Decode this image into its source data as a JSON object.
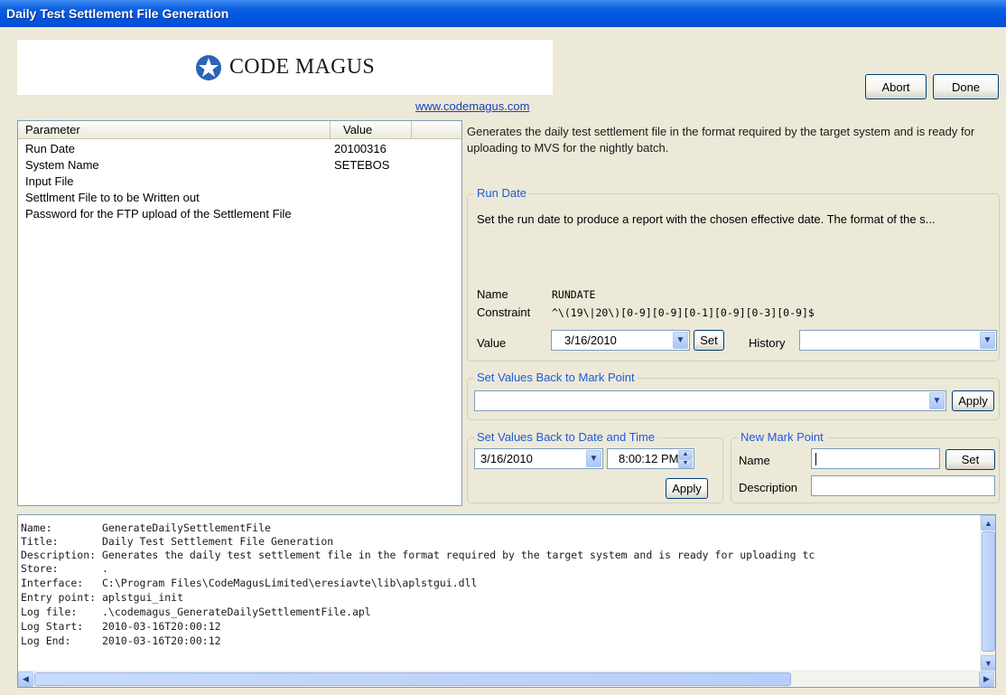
{
  "window": {
    "title": "Daily Test Settlement File Generation"
  },
  "logo": {
    "company": "Code Magus",
    "url": "www.codemagus.com"
  },
  "buttons": {
    "abort": "Abort",
    "done": "Done"
  },
  "parameters": {
    "headers": {
      "parameter": "Parameter",
      "value": "Value"
    },
    "rows": [
      {
        "name": "Run Date",
        "value": "20100316"
      },
      {
        "name": "System Name",
        "value": "SETEBOS"
      },
      {
        "name": "Input File",
        "value": ""
      },
      {
        "name": "Settlment File to to be Written out",
        "value": ""
      },
      {
        "name": "Password for the FTP upload of the Settlement File",
        "value": ""
      }
    ]
  },
  "description": "Generates the daily test settlement file in the format required by the target system and is ready for uploading to MVS for the nightly batch.",
  "run_date": {
    "legend": "Run Date",
    "text": "Set the run date to produce a report with the chosen effective date. The format of the s...",
    "name_label": "Name",
    "name_value": "RUNDATE",
    "constraint_label": "Constraint",
    "constraint_value": "^\\(19\\|20\\)[0-9][0-9][0-1][0-9][0-3][0-9]$",
    "value_label": "Value",
    "value": "3/16/2010",
    "set_label": "Set",
    "history_label": "History",
    "history_value": ""
  },
  "mark_point": {
    "legend": "Set Values Back to Mark Point",
    "value": "",
    "apply_label": "Apply"
  },
  "date_time": {
    "legend": "Set Values Back to Date and Time",
    "date": "3/16/2010",
    "time": "8:00:12 PM",
    "apply_label": "Apply"
  },
  "new_mark": {
    "legend": "New Mark Point",
    "name_label": "Name",
    "name_value": "",
    "description_label": "Description",
    "description_value": "",
    "set_label": "Set"
  },
  "log": {
    "lines": [
      "Name:        GenerateDailySettlementFile",
      "Title:       Daily Test Settlement File Generation",
      "Description: Generates the daily test settlement file in the format required by the target system and is ready for uploading tc",
      "Store:       .",
      "Interface:   C:\\Program Files\\CodeMagusLimited\\eresiavte\\lib\\aplstgui.dll",
      "Entry point: aplstgui_init",
      "Log file:    .\\codemagus_GenerateDailySettlementFile.apl",
      "Log Start:   2010-03-16T20:00:12",
      "Log End:     2010-03-16T20:00:12"
    ]
  },
  "colors": {
    "title_bar": "#0054e3",
    "legend_text": "#1f5bd8",
    "link": "#1a3fbf",
    "logo_star": "#2a63b8"
  },
  "icons": {
    "logo": "star-badge-icon",
    "dropdown": "chevron-down-icon",
    "spinner": "spinner-arrows-icon"
  }
}
